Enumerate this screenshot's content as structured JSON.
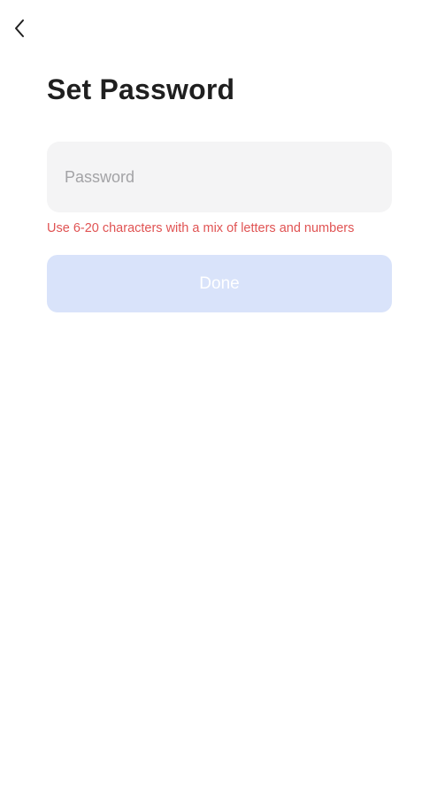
{
  "header": {
    "back_icon": "chevron-left-icon"
  },
  "page": {
    "title": "Set Password"
  },
  "password_field": {
    "placeholder": "Password",
    "value": ""
  },
  "hint": {
    "text": "Use 6-20 characters with a mix of letters and numbers",
    "color": "#e05353"
  },
  "done_button": {
    "label": "Done",
    "state": "disabled",
    "color": "#d9e3fa"
  }
}
